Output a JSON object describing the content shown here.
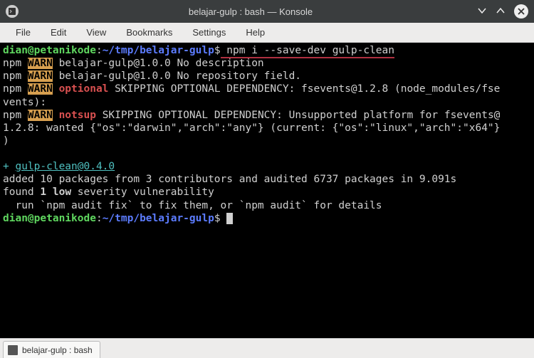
{
  "window": {
    "title": "belajar-gulp : bash — Konsole"
  },
  "menu": {
    "file": "File",
    "edit": "Edit",
    "view": "View",
    "bookmarks": "Bookmarks",
    "settings": "Settings",
    "help": "Help"
  },
  "prompt": {
    "user_host": "dian@petanikode",
    "sep": ":",
    "path": "~/tmp/belajar-gulp",
    "end": "$"
  },
  "commands": {
    "cmd1": " npm i --save-dev gulp-clean"
  },
  "output": {
    "l1a": "npm ",
    "l1b": "WARN",
    "l1c": " belajar-gulp@1.0.0 No description",
    "l2a": "npm ",
    "l2b": "WARN",
    "l2c": " belajar-gulp@1.0.0 No repository field.",
    "l3a": "npm ",
    "l3b": "WARN",
    "l3c": " ",
    "l3d": "optional",
    "l3e": " SKIPPING OPTIONAL DEPENDENCY: fsevents@1.2.8 (node_modules/fse",
    "l4": "vents):",
    "l5a": "npm ",
    "l5b": "WARN",
    "l5c": " ",
    "l5d": "notsup",
    "l5e": " SKIPPING OPTIONAL DEPENDENCY: Unsupported platform for fsevents@",
    "l6": "1.2.8: wanted {\"os\":\"darwin\",\"arch\":\"any\"} (current: {\"os\":\"linux\",\"arch\":\"x64\"}",
    "l7": ")",
    "l8": "",
    "l9a": "+ ",
    "l9b": "gulp-clean@0.4.0",
    "l10": "added 10 packages from 3 contributors and audited 6737 packages in 9.091s",
    "l11a": "found ",
    "l11b": "1",
    "l11c": " ",
    "l11d": "low",
    "l11e": " severity vulnerability",
    "l12": "  run `npm audit fix` to fix them, or `npm audit` for details"
  },
  "tab": {
    "label": "belajar-gulp : bash"
  }
}
